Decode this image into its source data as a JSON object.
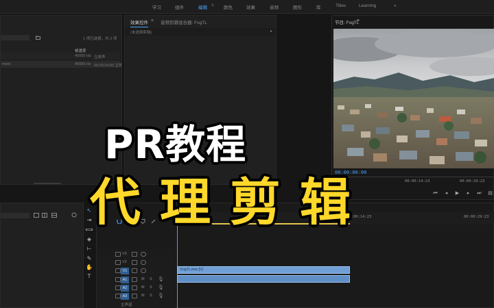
{
  "topbar": {
    "tabs": [
      "学习",
      "组件",
      "编辑",
      "颜色",
      "效果",
      "音频",
      "图形",
      "库",
      "Titles",
      "Learning"
    ],
    "active_index": 2,
    "tab_menu_glyph": "≡",
    "overflow_glyph": "»"
  },
  "project_panel": {
    "item_count": "1 项已选择，共 2 项",
    "column_frame_rate": "帧速率",
    "rows": [
      {
        "name": "",
        "rate": "40000 Hz",
        "extra": "立体声"
      },
      {
        "name": "ment",
        "rate": "40000 Hz",
        "extra": "00:00:24:00  立体声"
      }
    ],
    "bin_icon": "bin-icon"
  },
  "effect_controls": {
    "tab_active": "效果控件",
    "tab_menu_glyph": "≡",
    "tab_second": "音频剪辑混合器: FogTL",
    "no_clip": "(未选择剪辑)",
    "play_glyph": "▸"
  },
  "program_monitor": {
    "title": "节目: FogTL",
    "menu_glyph": "≡",
    "timecode": "00:00:00:00",
    "scrub_times": [
      "00:00:14:23",
      "00:00:29:23"
    ],
    "colors": {
      "timecode": "#4aa3ff"
    }
  },
  "timeline": {
    "tracks_video": [
      "V3",
      "V2",
      "V1"
    ],
    "tracks_audio": [
      "A1",
      "A2",
      "A3"
    ],
    "master": "主声道",
    "clip_name": "FogTL.mov [V]",
    "ruler_times": [
      "00:00:14:23",
      "00:00:29:23"
    ],
    "colors": {
      "clip": "#6f9fd6",
      "selected_track": "#2f5f92",
      "work_area": "#e6c84a"
    }
  },
  "tools": [
    "selection-tool",
    "track-select-tool",
    "ripple-edit-tool",
    "razor-tool",
    "slip-tool",
    "pen-tool",
    "hand-tool",
    "type-tool"
  ],
  "overlay": {
    "line1": "PR教程",
    "line2": "代理剪辑",
    "colors": {
      "line1": "#ffffff",
      "line2": "#ffd82a"
    }
  }
}
